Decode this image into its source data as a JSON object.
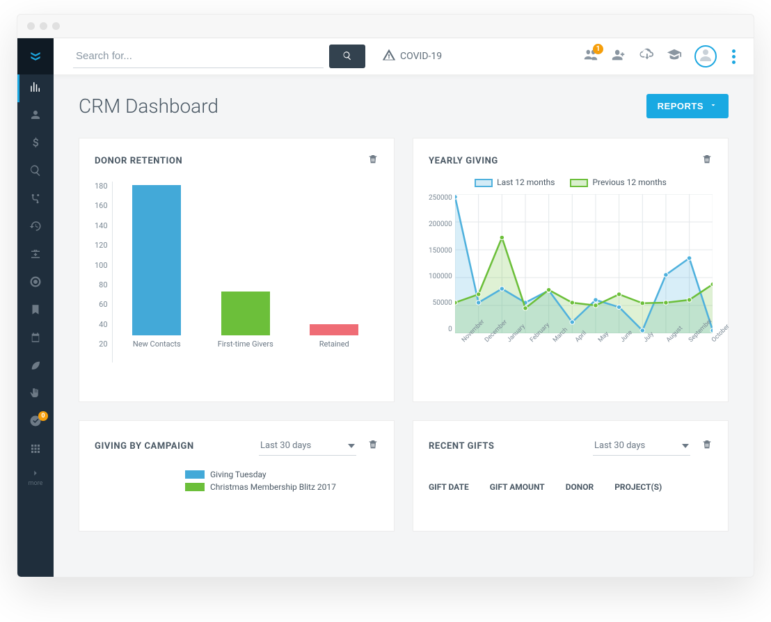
{
  "topbar": {
    "search_placeholder": "Search for...",
    "covid_label": "COVID-19",
    "people_badge": "1"
  },
  "sidebar": {
    "tasks_badge": "0",
    "more_label": "more"
  },
  "page": {
    "title": "CRM Dashboard",
    "reports_label": "REPORTS"
  },
  "cards": {
    "donor_retention": {
      "title": "DONOR RETENTION"
    },
    "yearly_giving": {
      "title": "YEARLY GIVING",
      "legend_a": "Last 12 months",
      "legend_b": "Previous 12 months"
    },
    "giving_by_campaign": {
      "title": "GIVING BY CAMPAIGN",
      "filter": "Last 30 days",
      "series": [
        {
          "label": "Giving Tuesday",
          "color": "#43a9d8"
        },
        {
          "label": "Christmas Membership Blitz 2017",
          "color": "#6cbf3a"
        }
      ]
    },
    "recent_gifts": {
      "title": "RECENT GIFTS",
      "filter": "Last 30 days",
      "columns": [
        "GIFT DATE",
        "GIFT AMOUNT",
        "DONOR",
        "PROJECT(S)"
      ]
    }
  },
  "chart_data": [
    {
      "id": "donor_retention",
      "type": "bar",
      "categories": [
        "New Contacts",
        "First-time Givers",
        "Retained"
      ],
      "values": [
        164,
        62,
        31
      ],
      "colors": [
        "#43a9d8",
        "#6cbf3a",
        "#ef6c75"
      ],
      "ylim": [
        20,
        180
      ],
      "yticks": [
        20,
        40,
        60,
        80,
        100,
        120,
        140,
        160,
        180
      ]
    },
    {
      "id": "yearly_giving",
      "type": "line",
      "x": [
        "November",
        "December",
        "January",
        "February",
        "March",
        "April",
        "May",
        "June",
        "July",
        "August",
        "September",
        "October"
      ],
      "yticks": [
        0,
        50000,
        100000,
        150000,
        200000,
        250000
      ],
      "ylim": [
        0,
        250000
      ],
      "series": [
        {
          "name": "Last 12 months",
          "color": "#4fb1dd",
          "fill": "rgba(79,177,221,.22)",
          "values": [
            245000,
            55000,
            80000,
            55000,
            77000,
            20000,
            60000,
            47000,
            5000,
            105000,
            135000,
            5000
          ]
        },
        {
          "name": "Previous 12 months",
          "color": "#6cbf3a",
          "fill": "rgba(108,191,58,.22)",
          "values": [
            55000,
            70000,
            172000,
            45000,
            78000,
            55000,
            50000,
            70000,
            54000,
            55000,
            60000,
            88000
          ]
        }
      ]
    }
  ]
}
